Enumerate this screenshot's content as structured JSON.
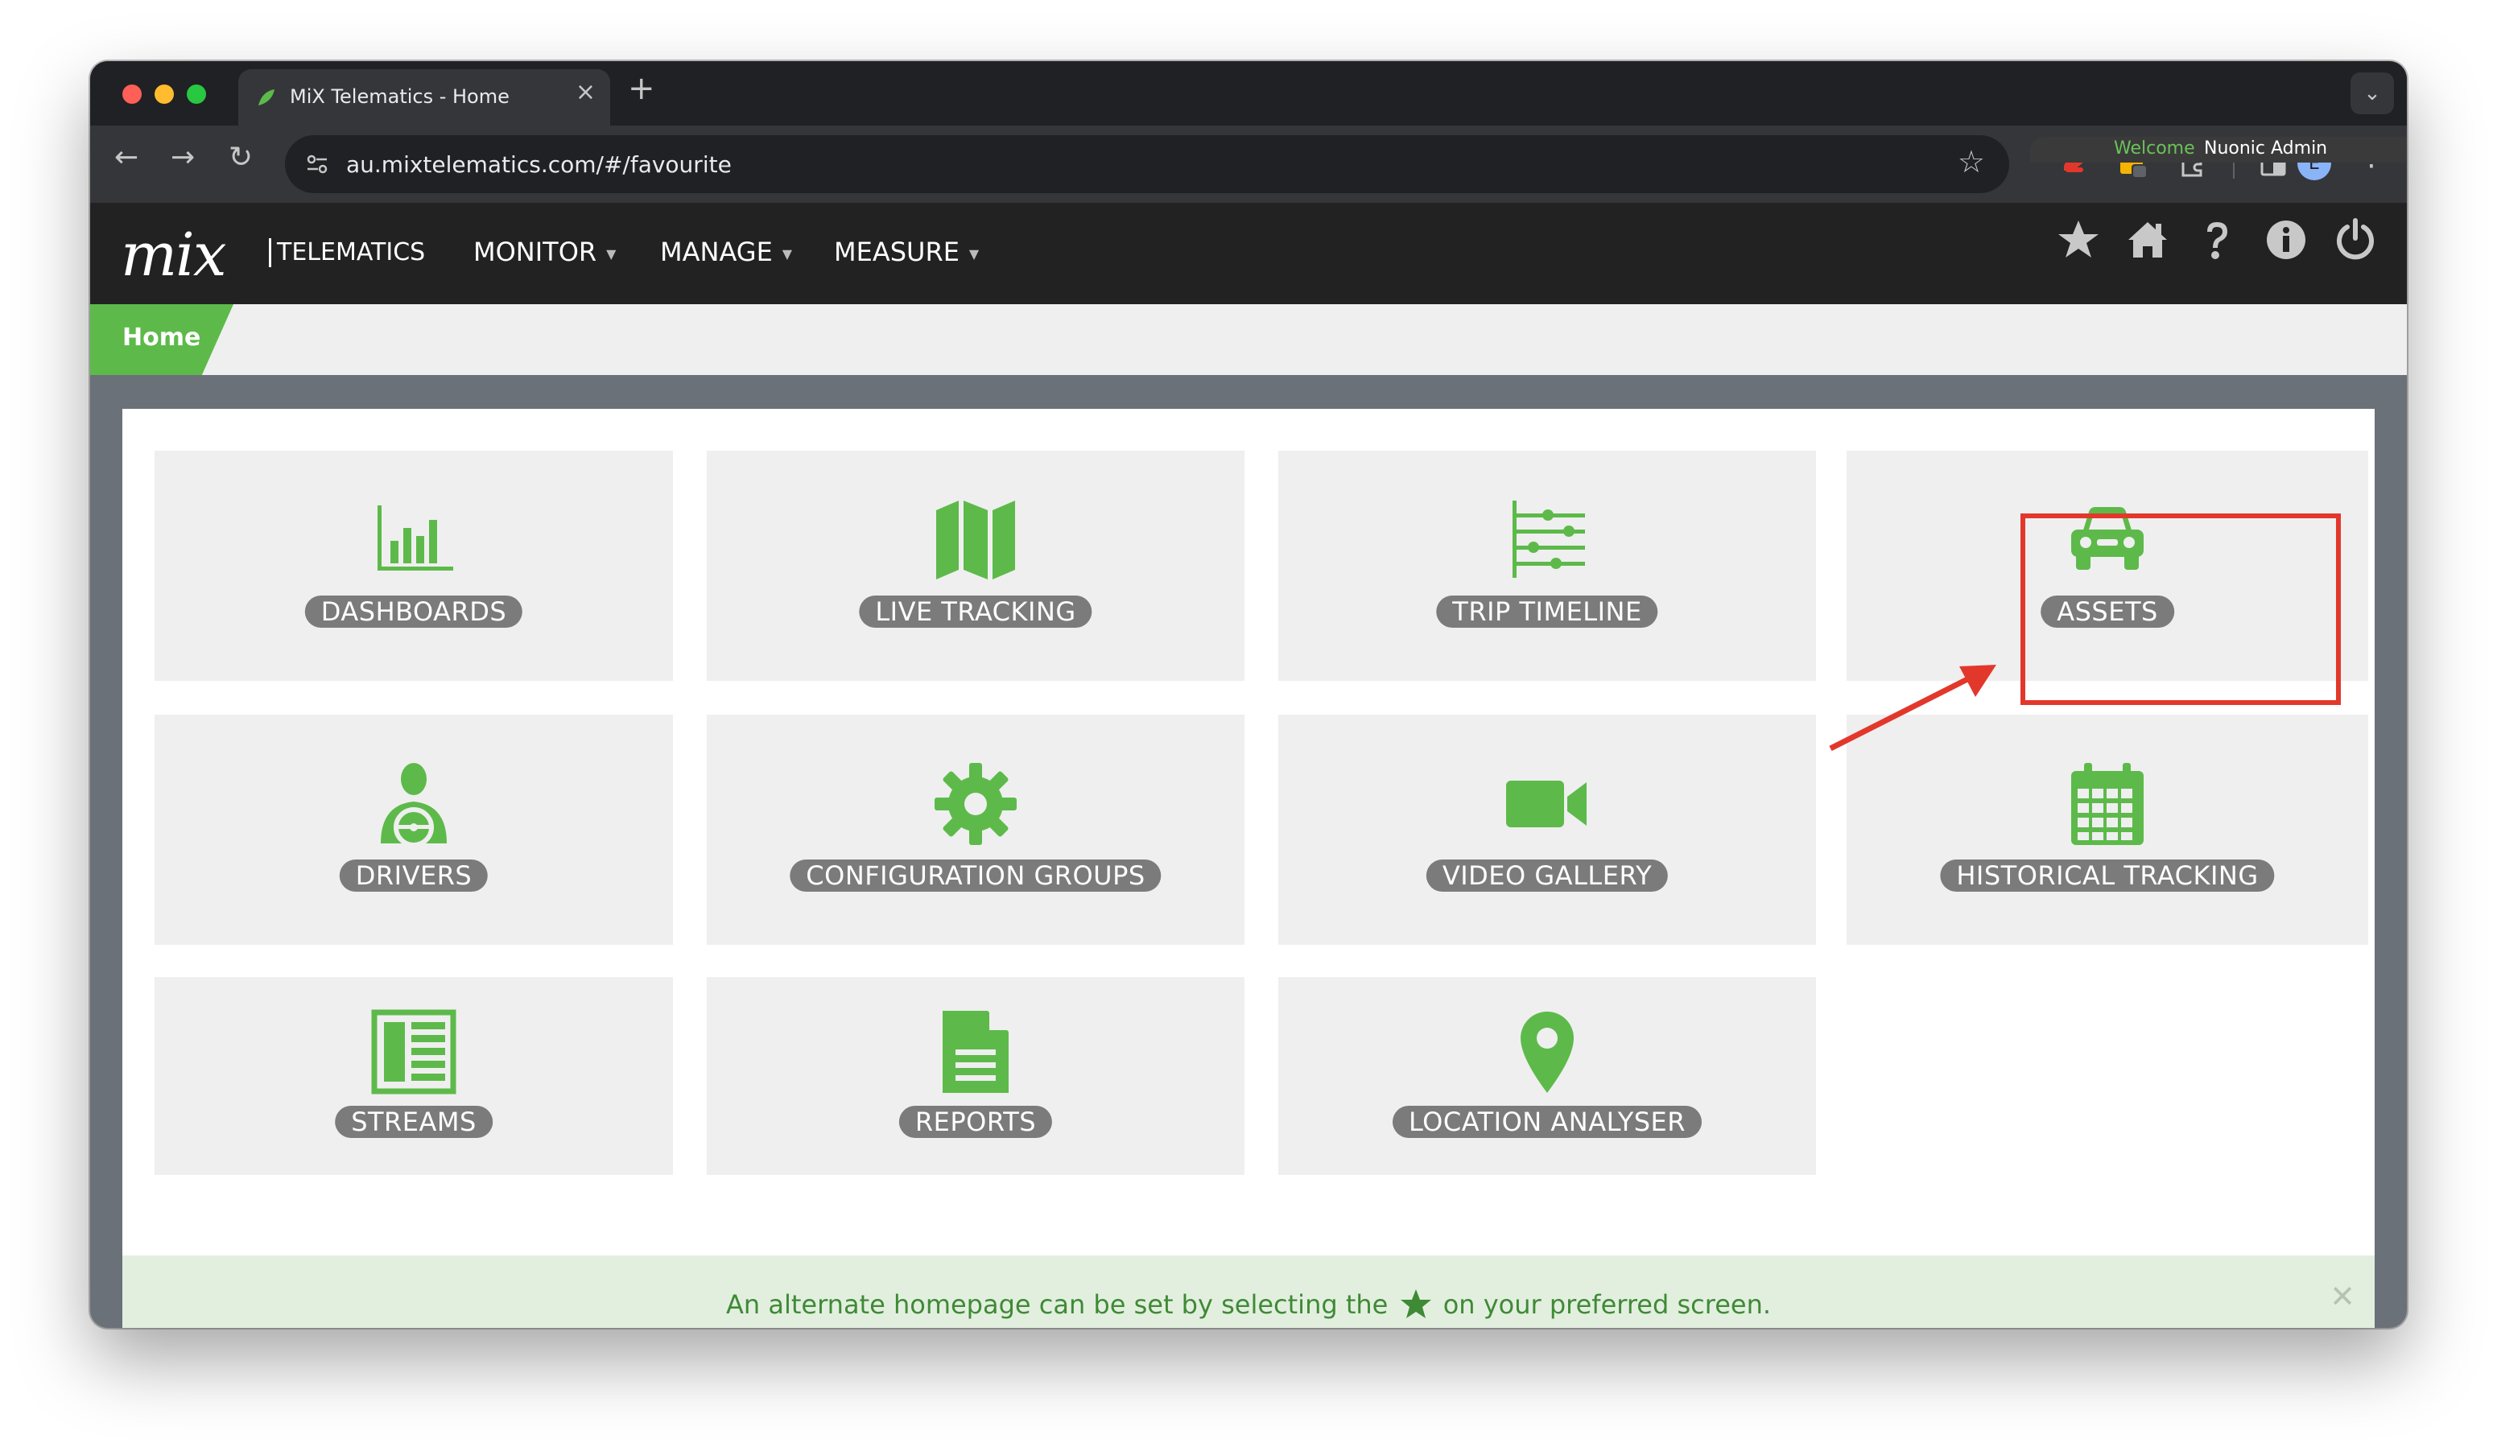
{
  "browser": {
    "tab_title": "MiX Telematics - Home",
    "tab_close": "×",
    "new_tab": "+",
    "url": "au.mixtelematics.com/#/favourite",
    "profile_initial": "E",
    "menu": "⋮",
    "back": "←",
    "forward": "→",
    "reload": "↻",
    "bookmark": "☆",
    "tab_list": "⌄"
  },
  "app": {
    "logo_script": "mix",
    "logo_text": "TELEMATICS",
    "nav": [
      {
        "label": "MONITOR"
      },
      {
        "label": "MANAGE"
      },
      {
        "label": "MEASURE"
      }
    ],
    "caret": "▼",
    "welcome_label": "Welcome",
    "welcome_user": "Nuonic Admin",
    "accent": "#5dba4a"
  },
  "breadcrumb": {
    "home": "Home"
  },
  "tiles": [
    {
      "label": "DASHBOARDS",
      "icon": "bar-chart-icon"
    },
    {
      "label": "LIVE TRACKING",
      "icon": "map-icon"
    },
    {
      "label": "TRIP TIMELINE",
      "icon": "timeline-icon"
    },
    {
      "label": "ASSETS",
      "icon": "car-icon"
    },
    {
      "label": "DRIVERS",
      "icon": "driver-icon"
    },
    {
      "label": "CONFIGURATION GROUPS",
      "icon": "gear-icon"
    },
    {
      "label": "VIDEO GALLERY",
      "icon": "video-camera-icon"
    },
    {
      "label": "HISTORICAL TRACKING",
      "icon": "calendar-icon"
    },
    {
      "label": "STREAMS",
      "icon": "streams-icon"
    },
    {
      "label": "REPORTS",
      "icon": "document-icon"
    },
    {
      "label": "LOCATION ANALYSER",
      "icon": "map-pin-icon"
    }
  ],
  "notice": {
    "before": "An alternate homepage can be set by selecting the",
    "after": "on your preferred screen.",
    "close": "✕"
  }
}
